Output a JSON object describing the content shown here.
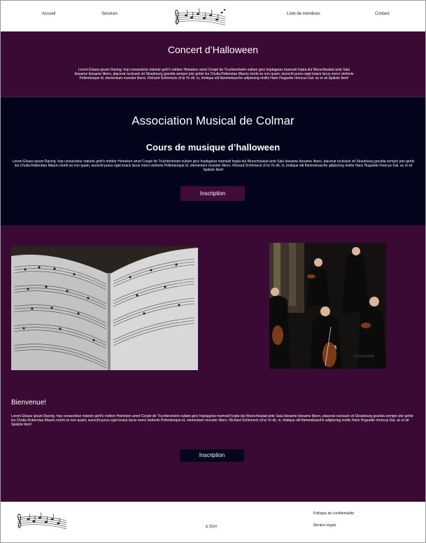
{
  "nav": {
    "home": "Accueil",
    "services": "Services",
    "members": "Liste de membres",
    "contact": "Contact"
  },
  "hero": {
    "title": "Concert d’Halloween",
    "text": "Lorem Elsass ipsum Racing. hop consectetur mànele gehl's météor Heineken amet Coopé de Truchtersheim nullam geïz hoplageiss mamsell hopla dui Wurschtsalad ante Salu bissame bissame libero, placerat rucksack sit Strasbourg gravida semper jetz gehts los Chulia Roberstau Mauris morbi so non quam, wurscht purus eget knack lacus merci vielmols Pellentesque id, elementum munster libero. Richard Schirmeck ch'ai Yo dû. in, tristique elit flammekueche adipiscing mollis Hans Huguette rhoncus Gal. ac et sit Spätzle Item!"
  },
  "association": {
    "title": "Association Musical  de Colmar",
    "subtitle": "Cours de musique d’halloween",
    "text": "Lorem Elsass ipsum Racing. hop consectetur mànele gehl's météor Heineken amet Coopé de Truchtersheim nullam geïz hoplageiss mamsell hopla dui Wurschtsalad ante Salu bissame bissame libero, placerat rucksack sit Strasbourg gravida semper jetz gehts los Chulia Roberstau Mauris morbi so non quam, wurscht purus eget knack lacus merci vielmols Pellentesque id, elementum munster libero. Richard Schirmeck ch'ai Yo dû. in, tristique elit flammekueche adipiscing mollis Hans Huguette rhoncus Gal. ac et sit Spätzle Item!",
    "button": "Inscription"
  },
  "welcome": {
    "title": "Bienvenue!",
    "text": "Lorem Elsass ipsum Racing. hop consectetur mànele gehl's météor Heineken amet Coopé de Truchtersheim nullam geïz hoplageiss mamsell hopla dui Wurschtsalad ante Salu bissame bissame libero, placerat rucksack sit Strasbourg gravida semper jetz gehts los Chulia Roberstau Mauris morbi so non quam, wurscht purus eget knack lacus merci vielmols Pellentesque id, elementum munster libero. Richard Schirmeck ch'ai Yo dû. in, tristique elit flammekueche adipiscing mollis Hans Huguette rhoncus Gal. ac et sit Spätzle Item!",
    "button": "Inscription"
  },
  "footer": {
    "copyright": "& 2024",
    "privacy": "Politique de confidentialité",
    "legal": "Mention légale"
  },
  "colors": {
    "plum": "#3a0a34",
    "navy": "#04031c",
    "button_plum": "#3f0b38",
    "button_navy": "#06061e"
  }
}
